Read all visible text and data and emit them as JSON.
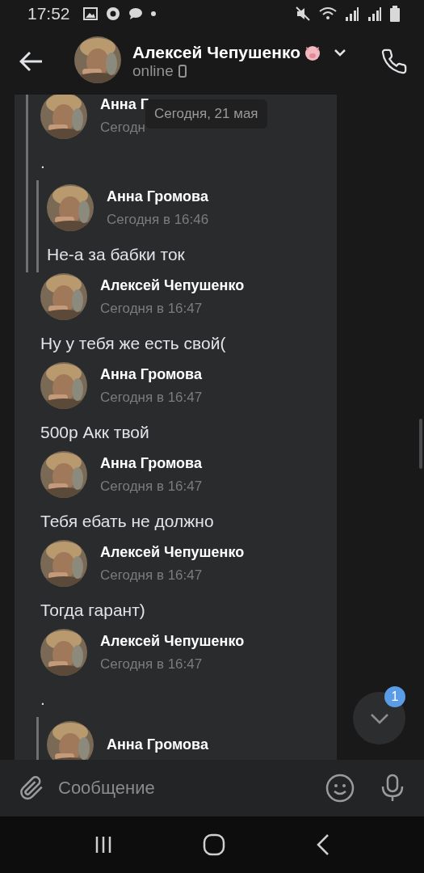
{
  "status_bar": {
    "time": "17:52"
  },
  "header": {
    "title": "Алексей Чепушенко",
    "status": "online"
  },
  "date_pill": "Сегодня, 21 мая",
  "messages": [
    {
      "kind": "quote",
      "messages": [
        {
          "author": "Анна Г",
          "time": "Сегодн",
          "text": ".",
          "forwarded": [
            {
              "author": "Анна Громова",
              "time": "Сегодня в 16:46",
              "text": "Не-а за бабки ток"
            }
          ]
        }
      ]
    },
    {
      "kind": "message",
      "author": "Алексей Чепушенко",
      "time": "Сегодня в 16:47",
      "text": "Ну у тебя же есть свой("
    },
    {
      "kind": "message",
      "author": "Анна Громова",
      "time": "Сегодня в 16:47",
      "text": "500р Акк твой"
    },
    {
      "kind": "message",
      "author": "Анна Громова",
      "time": "Сегодня в 16:47",
      "text": "Тебя ебать не должно"
    },
    {
      "kind": "message",
      "author": "Алексей Чепушенко",
      "time": "Сегодня в 16:47",
      "text": "Тогда гарант)"
    },
    {
      "kind": "message",
      "author": "Алексей Чепушенко",
      "time": "Сегодня в 16:47",
      "text": ".",
      "forwarded": [
        {
          "author": "Анна Громова"
        }
      ]
    }
  ],
  "scroll_button": {
    "badge": "1"
  },
  "composer": {
    "placeholder": "Сообщение"
  }
}
